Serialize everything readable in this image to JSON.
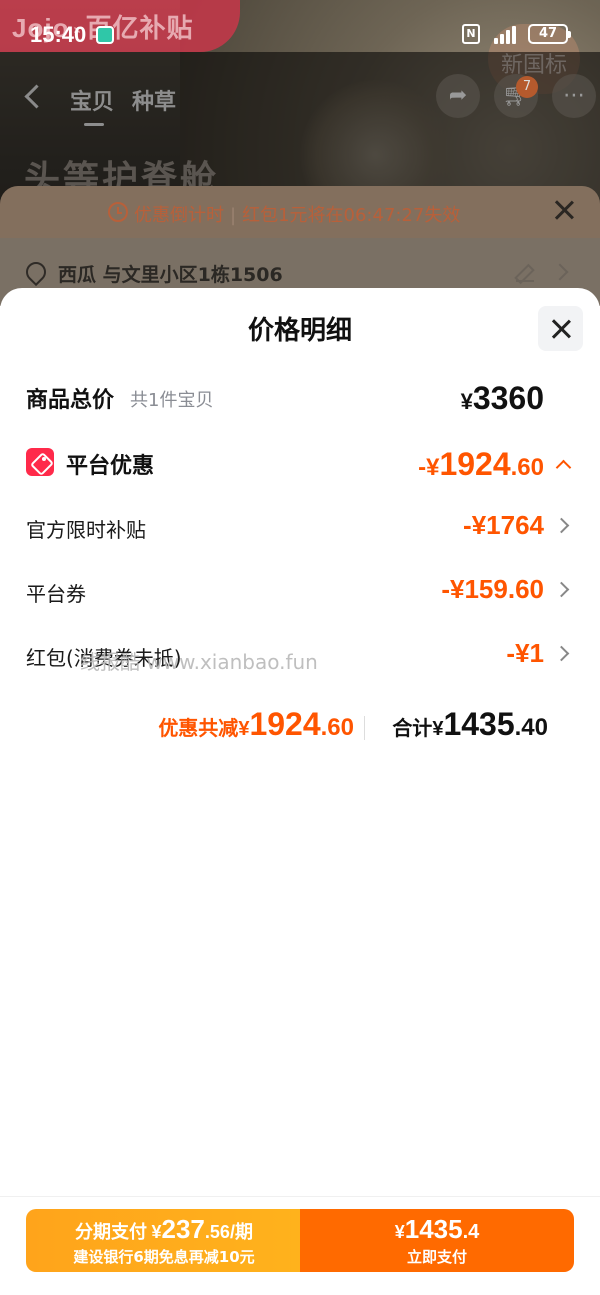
{
  "status_bar": {
    "time": "15:40",
    "battery": "47"
  },
  "background_page": {
    "brand_left": "Jojo",
    "brand_right": "百亿补贴",
    "promo_badge": "新国标",
    "tabs": [
      {
        "label": "宝贝"
      },
      {
        "label": "种草"
      }
    ],
    "cart_count": "7",
    "headline": "头等护脊舱",
    "countdown": {
      "label": "优惠倒计时",
      "message": "红包1元将在06:47:27失效"
    },
    "address": "西瓜 与文里小区1栋1506"
  },
  "sheet": {
    "title": "价格明细",
    "total_row": {
      "label": "商品总价",
      "sub": "共1件宝贝",
      "currency": "¥",
      "amount": "3360"
    },
    "platform_row": {
      "label": "平台优惠",
      "prefix": "-¥",
      "amount_int": "1924",
      "amount_dec": ".60"
    },
    "detail_rows": [
      {
        "label": "官方限时补贴",
        "amount": "-¥1764"
      },
      {
        "label": "平台券",
        "amount": "-¥159.60"
      },
      {
        "label": "红包(消费券未抵)",
        "amount": "-¥1"
      }
    ],
    "watermark": "线报酷 www.xianbao.fun",
    "summary": {
      "discount_label": "优惠共减",
      "discount_currency": "¥",
      "discount_int": "1924",
      "discount_dec": ".60",
      "total_label": "合计",
      "total_currency": "¥",
      "total_int": "1435",
      "total_dec": ".40"
    }
  },
  "bottom_bar": {
    "installment": {
      "label": "分期支付",
      "currency": "¥",
      "amount_int": "237",
      "amount_dec": ".56",
      "unit": "/期",
      "note": "建设银行6期免息再减10元"
    },
    "pay": {
      "currency": "¥",
      "amount_int": "1435",
      "amount_dec": ".4",
      "label": "立即支付"
    }
  },
  "colors": {
    "accent": "#ff5500",
    "pay_button": "#ff6a00",
    "installment_button": "#ffa41b",
    "coupon_icon": "#ff2a4a"
  },
  "icons": [
    "back-icon",
    "share-icon",
    "cart-icon",
    "more-icon",
    "clock-icon",
    "close-icon",
    "location-pin-icon",
    "edit-icon",
    "chevron-right-icon",
    "chevron-up-icon",
    "coupon-tag-icon"
  ]
}
